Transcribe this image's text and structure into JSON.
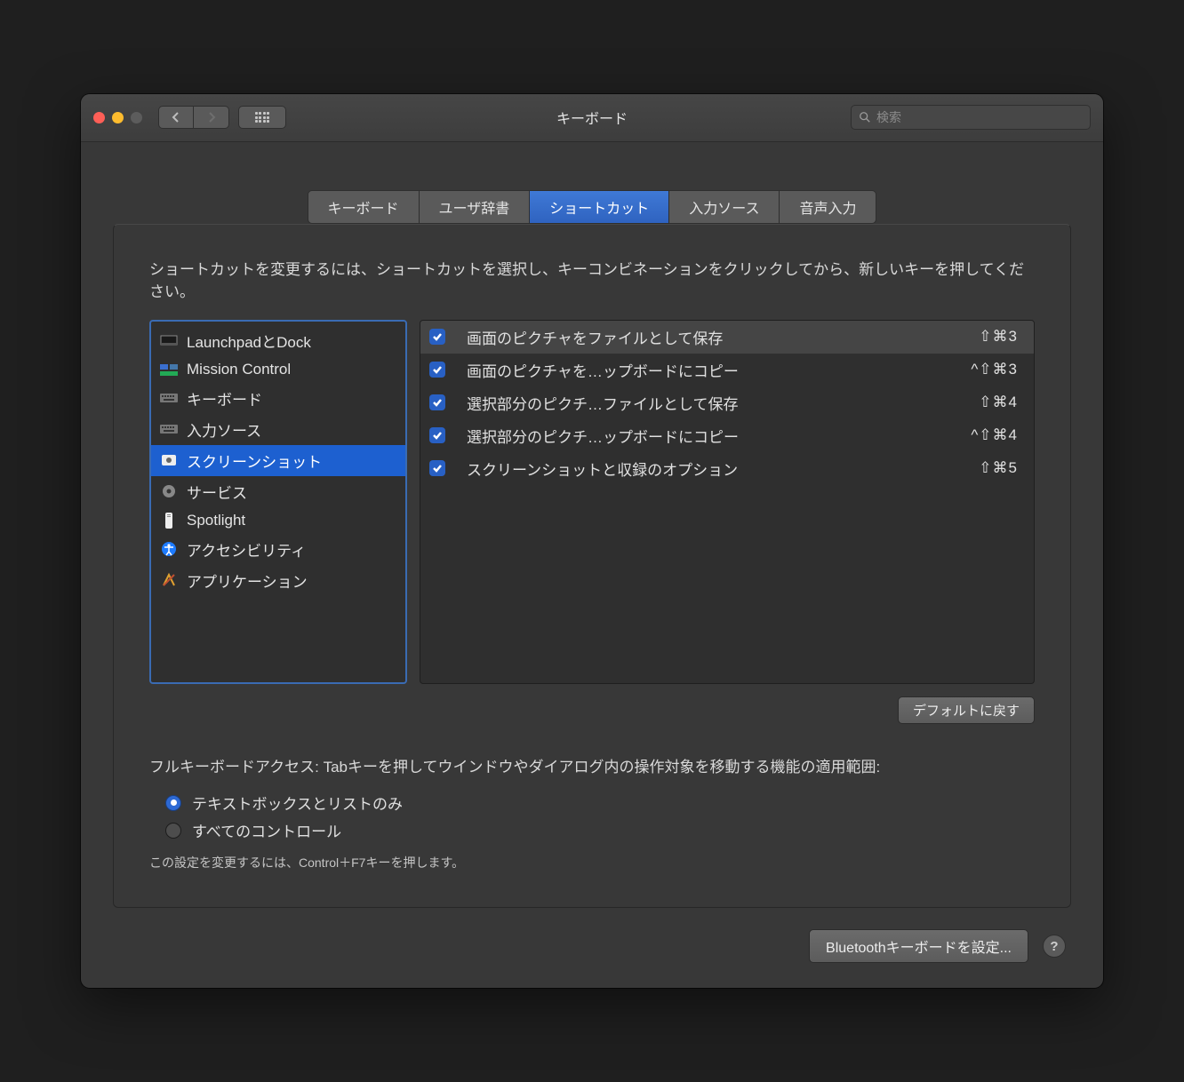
{
  "title": "キーボード",
  "search": {
    "placeholder": "検索"
  },
  "tabs": [
    {
      "label": "キーボード"
    },
    {
      "label": "ユーザ辞書"
    },
    {
      "label": "ショートカット",
      "selected": true
    },
    {
      "label": "入力ソース"
    },
    {
      "label": "音声入力"
    }
  ],
  "instruction": "ショートカットを変更するには、ショートカットを選択し、キーコンビネーションをクリックしてから、新しいキーを押してください。",
  "categories": [
    {
      "icon": "launchpad",
      "label": "LaunchpadとDock"
    },
    {
      "icon": "mission",
      "label": "Mission Control"
    },
    {
      "icon": "keyboard",
      "label": "キーボード"
    },
    {
      "icon": "keyboard",
      "label": "入力ソース"
    },
    {
      "icon": "screenshot",
      "label": "スクリーンショット",
      "selected": true
    },
    {
      "icon": "gear",
      "label": "サービス"
    },
    {
      "icon": "spotlight",
      "label": "Spotlight"
    },
    {
      "icon": "accessibility",
      "label": "アクセシビリティ"
    },
    {
      "icon": "app",
      "label": "アプリケーション"
    }
  ],
  "shortcuts": [
    {
      "checked": true,
      "label": "画面のピクチャをファイルとして保存",
      "keys": "⇧⌘3",
      "highlight": true
    },
    {
      "checked": true,
      "label": "画面のピクチャを…ップボードにコピー",
      "keys": "^⇧⌘3"
    },
    {
      "checked": true,
      "label": "選択部分のピクチ…ファイルとして保存",
      "keys": "⇧⌘4"
    },
    {
      "checked": true,
      "label": "選択部分のピクチ…ップボードにコピー",
      "keys": "^⇧⌘4"
    },
    {
      "checked": true,
      "label": "スクリーンショットと収録のオプション",
      "keys": "⇧⌘5"
    }
  ],
  "buttons": {
    "restore_defaults": "デフォルトに戻す",
    "bluetooth": "Bluetoothキーボードを設定..."
  },
  "fka": {
    "label": "フルキーボードアクセス: Tabキーを押してウインドウやダイアログ内の操作対象を移動する機能の適用範囲:",
    "options": [
      {
        "label": "テキストボックスとリストのみ",
        "checked": true
      },
      {
        "label": "すべてのコントロール",
        "checked": false
      }
    ],
    "hint": "この設定を変更するには、Control＋F7キーを押します。"
  }
}
